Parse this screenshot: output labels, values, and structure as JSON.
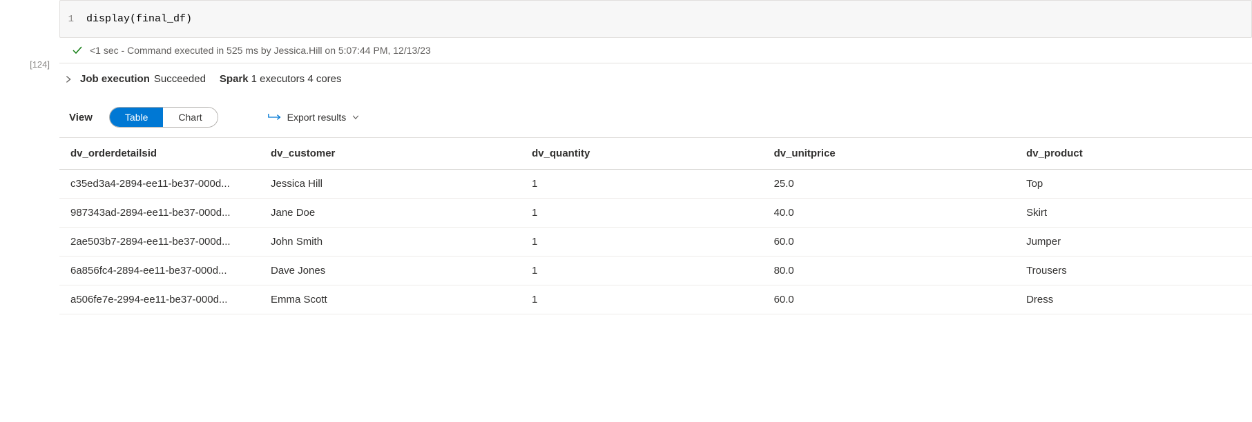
{
  "cell_number": "[124]",
  "code": {
    "line_num": "1",
    "text": "display(final_df)"
  },
  "status": {
    "text": "<1 sec - Command executed in 525 ms by Jessica.Hill on 5:07:44 PM, 12/13/23"
  },
  "job": {
    "label": "Job execution",
    "status": "Succeeded",
    "spark_label": "Spark",
    "spark_detail": "1 executors 4 cores"
  },
  "view": {
    "label": "View",
    "table_label": "Table",
    "chart_label": "Chart",
    "export_label": "Export results"
  },
  "table": {
    "headers": [
      "dv_orderdetailsid",
      "dv_customer",
      "dv_quantity",
      "dv_unitprice",
      "dv_product"
    ],
    "rows": [
      [
        "c35ed3a4-2894-ee11-be37-000d...",
        "Jessica Hill",
        "1",
        "25.0",
        "Top"
      ],
      [
        "987343ad-2894-ee11-be37-000d...",
        "Jane Doe",
        "1",
        "40.0",
        "Skirt"
      ],
      [
        "2ae503b7-2894-ee11-be37-000d...",
        "John Smith",
        "1",
        "60.0",
        "Jumper"
      ],
      [
        "6a856fc4-2894-ee11-be37-000d...",
        "Dave Jones",
        "1",
        "80.0",
        "Trousers"
      ],
      [
        "a506fe7e-2994-ee11-be37-000d...",
        "Emma Scott",
        "1",
        "60.0",
        "Dress"
      ]
    ]
  }
}
